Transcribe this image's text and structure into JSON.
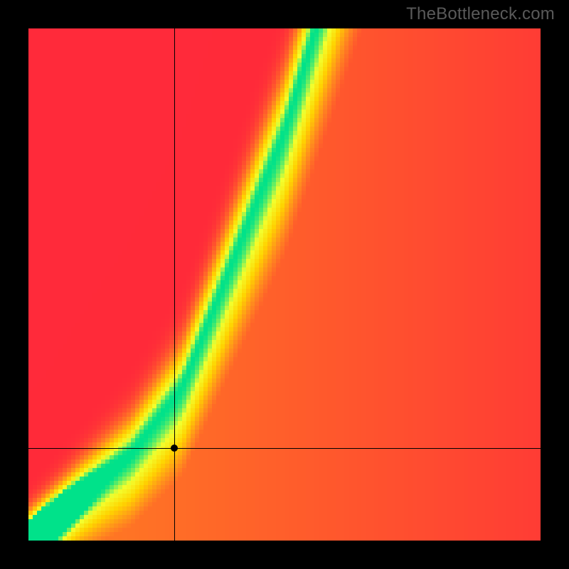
{
  "attribution": "TheBottleneck.com",
  "chart_data": {
    "type": "heatmap",
    "title": "",
    "xlabel": "",
    "ylabel": "",
    "xlim": [
      0,
      1
    ],
    "ylim": [
      0,
      1
    ],
    "grid": false,
    "legend": false,
    "crosshair": {
      "x": 0.285,
      "y": 0.18
    },
    "marker": {
      "x": 0.285,
      "y": 0.18
    },
    "optimal_ridge": {
      "description": "green band of low-bottleneck combinations running diagonally; below ~x=0.25 it follows y≈x, above that it steepens toward y≈2.4x-0.35",
      "sample_points": [
        {
          "x": 0.0,
          "y": 0.0
        },
        {
          "x": 0.1,
          "y": 0.09
        },
        {
          "x": 0.2,
          "y": 0.17
        },
        {
          "x": 0.3,
          "y": 0.3
        },
        {
          "x": 0.4,
          "y": 0.55
        },
        {
          "x": 0.5,
          "y": 0.8
        },
        {
          "x": 0.56,
          "y": 1.0
        }
      ],
      "band_width_fraction_at_mid": 0.1
    },
    "color_scale": {
      "worst": "#ff2a3a",
      "mid_low": "#ff8a1f",
      "mid": "#ffd400",
      "mid_high": "#f3ff2e",
      "best": "#00e28a"
    },
    "resolution_cells": 120,
    "description": "Heatmap shading from red (high bottleneck) through orange/yellow to green (balanced) along a steep diagonal ridge. A crosshair with a black dot marks a queried configuration at roughly (0.285, 0.18) of the plot area, sitting just below/right of the green ridge in the yellow-orange transition."
  }
}
